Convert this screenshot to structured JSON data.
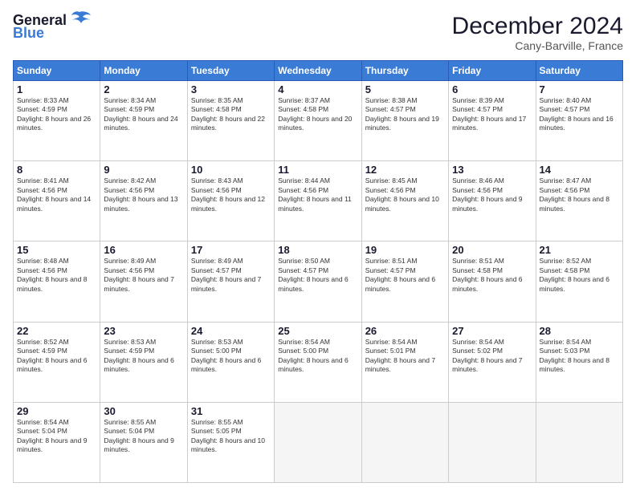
{
  "header": {
    "logo_line1": "General",
    "logo_line2": "Blue",
    "month": "December 2024",
    "location": "Cany-Barville, France"
  },
  "weekdays": [
    "Sunday",
    "Monday",
    "Tuesday",
    "Wednesday",
    "Thursday",
    "Friday",
    "Saturday"
  ],
  "weeks": [
    [
      {
        "day": "1",
        "sunrise": "8:33 AM",
        "sunset": "4:59 PM",
        "daylight": "8 hours and 26 minutes."
      },
      {
        "day": "2",
        "sunrise": "8:34 AM",
        "sunset": "4:59 PM",
        "daylight": "8 hours and 24 minutes."
      },
      {
        "day": "3",
        "sunrise": "8:35 AM",
        "sunset": "4:58 PM",
        "daylight": "8 hours and 22 minutes."
      },
      {
        "day": "4",
        "sunrise": "8:37 AM",
        "sunset": "4:58 PM",
        "daylight": "8 hours and 20 minutes."
      },
      {
        "day": "5",
        "sunrise": "8:38 AM",
        "sunset": "4:57 PM",
        "daylight": "8 hours and 19 minutes."
      },
      {
        "day": "6",
        "sunrise": "8:39 AM",
        "sunset": "4:57 PM",
        "daylight": "8 hours and 17 minutes."
      },
      {
        "day": "7",
        "sunrise": "8:40 AM",
        "sunset": "4:57 PM",
        "daylight": "8 hours and 16 minutes."
      }
    ],
    [
      {
        "day": "8",
        "sunrise": "8:41 AM",
        "sunset": "4:56 PM",
        "daylight": "8 hours and 14 minutes."
      },
      {
        "day": "9",
        "sunrise": "8:42 AM",
        "sunset": "4:56 PM",
        "daylight": "8 hours and 13 minutes."
      },
      {
        "day": "10",
        "sunrise": "8:43 AM",
        "sunset": "4:56 PM",
        "daylight": "8 hours and 12 minutes."
      },
      {
        "day": "11",
        "sunrise": "8:44 AM",
        "sunset": "4:56 PM",
        "daylight": "8 hours and 11 minutes."
      },
      {
        "day": "12",
        "sunrise": "8:45 AM",
        "sunset": "4:56 PM",
        "daylight": "8 hours and 10 minutes."
      },
      {
        "day": "13",
        "sunrise": "8:46 AM",
        "sunset": "4:56 PM",
        "daylight": "8 hours and 9 minutes."
      },
      {
        "day": "14",
        "sunrise": "8:47 AM",
        "sunset": "4:56 PM",
        "daylight": "8 hours and 8 minutes."
      }
    ],
    [
      {
        "day": "15",
        "sunrise": "8:48 AM",
        "sunset": "4:56 PM",
        "daylight": "8 hours and 8 minutes."
      },
      {
        "day": "16",
        "sunrise": "8:49 AM",
        "sunset": "4:56 PM",
        "daylight": "8 hours and 7 minutes."
      },
      {
        "day": "17",
        "sunrise": "8:49 AM",
        "sunset": "4:57 PM",
        "daylight": "8 hours and 7 minutes."
      },
      {
        "day": "18",
        "sunrise": "8:50 AM",
        "sunset": "4:57 PM",
        "daylight": "8 hours and 6 minutes."
      },
      {
        "day": "19",
        "sunrise": "8:51 AM",
        "sunset": "4:57 PM",
        "daylight": "8 hours and 6 minutes."
      },
      {
        "day": "20",
        "sunrise": "8:51 AM",
        "sunset": "4:58 PM",
        "daylight": "8 hours and 6 minutes."
      },
      {
        "day": "21",
        "sunrise": "8:52 AM",
        "sunset": "4:58 PM",
        "daylight": "8 hours and 6 minutes."
      }
    ],
    [
      {
        "day": "22",
        "sunrise": "8:52 AM",
        "sunset": "4:59 PM",
        "daylight": "8 hours and 6 minutes."
      },
      {
        "day": "23",
        "sunrise": "8:53 AM",
        "sunset": "4:59 PM",
        "daylight": "8 hours and 6 minutes."
      },
      {
        "day": "24",
        "sunrise": "8:53 AM",
        "sunset": "5:00 PM",
        "daylight": "8 hours and 6 minutes."
      },
      {
        "day": "25",
        "sunrise": "8:54 AM",
        "sunset": "5:00 PM",
        "daylight": "8 hours and 6 minutes."
      },
      {
        "day": "26",
        "sunrise": "8:54 AM",
        "sunset": "5:01 PM",
        "daylight": "8 hours and 7 minutes."
      },
      {
        "day": "27",
        "sunrise": "8:54 AM",
        "sunset": "5:02 PM",
        "daylight": "8 hours and 7 minutes."
      },
      {
        "day": "28",
        "sunrise": "8:54 AM",
        "sunset": "5:03 PM",
        "daylight": "8 hours and 8 minutes."
      }
    ],
    [
      {
        "day": "29",
        "sunrise": "8:54 AM",
        "sunset": "5:04 PM",
        "daylight": "8 hours and 9 minutes."
      },
      {
        "day": "30",
        "sunrise": "8:55 AM",
        "sunset": "5:04 PM",
        "daylight": "8 hours and 9 minutes."
      },
      {
        "day": "31",
        "sunrise": "8:55 AM",
        "sunset": "5:05 PM",
        "daylight": "8 hours and 10 minutes."
      },
      null,
      null,
      null,
      null
    ]
  ]
}
